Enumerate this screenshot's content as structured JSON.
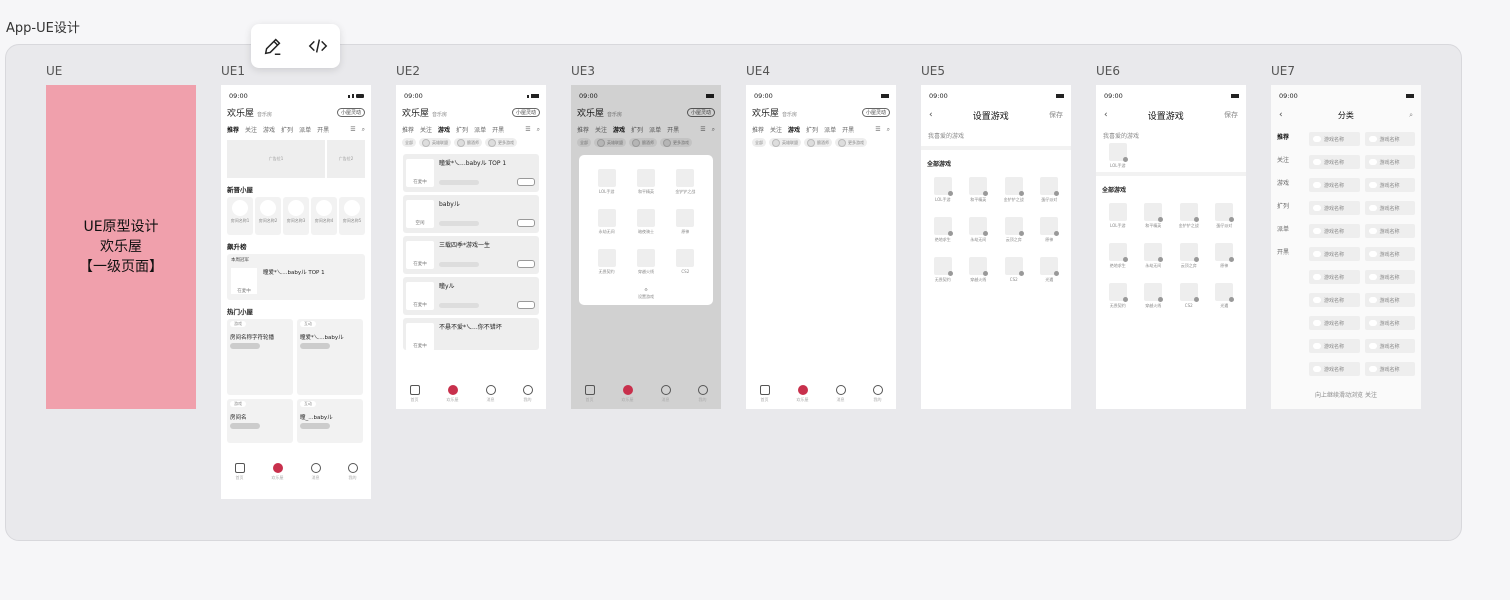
{
  "page_title": "App-UE设计",
  "toolbar": {
    "edit_icon": "pencil-icon",
    "code_icon": "code-icon"
  },
  "frames": [
    "UE",
    "UE1",
    "UE2",
    "UE3",
    "UE4",
    "UE5",
    "UE6",
    "UE7"
  ],
  "cover": {
    "line1": "UE原型设计",
    "line2": "欢乐屋",
    "line3": "【一级页面】"
  },
  "status_time": "09:00",
  "header": {
    "title": "欢乐屋",
    "sub": "音乐房",
    "pill": "小屋灵动"
  },
  "tabs": [
    "推荐",
    "关注",
    "游戏",
    "扩列",
    "派单",
    "开黑"
  ],
  "chips": [
    "全部",
    "英雄联盟",
    "酿酒师",
    "更多游戏"
  ],
  "ue1": {
    "banner": [
      "广告位1",
      "广告位2"
    ],
    "new_rooms_title": "新晋小屋",
    "new_rooms": [
      "房间名称1",
      "房间名称2",
      "房间名称3",
      "房间名称4",
      "房间名称5"
    ],
    "rank_title": "飙升榜",
    "rank_header": "本周冠军",
    "rank_item": "瞳爱*乀...babyル TOP 1",
    "rank_status": "在麦中",
    "hot_title": "热门小屋",
    "hot": [
      {
        "tag": "游戏",
        "title": "房间名称字符轮播"
      },
      {
        "tag": "互动",
        "title": "瞳爱*乀...babyル"
      },
      {
        "tag": "游戏",
        "title": "房间名"
      },
      {
        "tag": "互动",
        "title": "瞳_...babyル"
      }
    ]
  },
  "ue2": {
    "cards": [
      {
        "title": "瞳爱*乀...babyル TOP 1",
        "status": "在麦中"
      },
      {
        "title": "babyル",
        "status": "空闲"
      },
      {
        "title": "三载四季*游戏一生",
        "status": "在麦中"
      },
      {
        "title": "瞳yル",
        "status": "在麦中"
      },
      {
        "title": "不悬不爱*乀...你不错坏",
        "status": "在麦中"
      }
    ]
  },
  "tabbar": [
    "首页",
    "欢乐屋",
    "消息",
    "我的"
  ],
  "games": [
    "LOL手游",
    "和平精英",
    "金铲铲之战",
    "永劫无间",
    "暗夜骑士",
    "原神",
    "无畏契约",
    "穿越火线",
    "CS2"
  ],
  "games_ue5": [
    "LOL手游",
    "和平精英",
    "金铲铲之战",
    "蛋仔派对",
    "绝地求生",
    "永劫无间",
    "云顶之弈",
    "原神",
    "无畏契约",
    "穿越火线",
    "CS2",
    "光遇"
  ],
  "popup_footer": "设置游戏",
  "settings": {
    "title": "设置游戏",
    "save": "保存",
    "fav": "我喜爱的游戏",
    "all": "全部游戏",
    "fav_item": "LOL手游"
  },
  "ue7": {
    "title": "分类",
    "left": [
      "推荐",
      "关注",
      "游戏",
      "扩列",
      "派单",
      "开黑"
    ],
    "item": "游戏名称",
    "footer": "向上继续滑动浏览  关注"
  }
}
